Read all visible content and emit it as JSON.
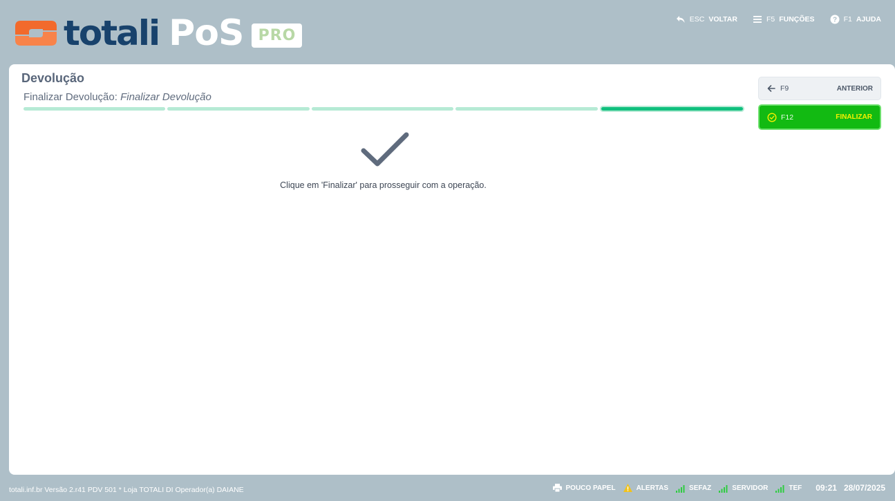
{
  "header": {
    "logo_word": "totali",
    "logo_pos": "PoS",
    "logo_badge": "PRO",
    "actions": [
      {
        "icon": "undo-icon",
        "key": "ESC",
        "label": "VOLTAR"
      },
      {
        "icon": "menu-icon",
        "key": "F5",
        "label": "FUNÇÕES"
      },
      {
        "icon": "help-icon",
        "key": "F1",
        "label": "AJUDA"
      }
    ]
  },
  "main": {
    "title": "Devolução",
    "step_prefix": "Finalizar Devolução:",
    "step_name": "Finalizar Devolução",
    "progress": {
      "total_steps": 5,
      "current_step": 5
    },
    "message": "Clique em 'Finalizar' para prosseguir com a operação.",
    "icon": "checkmark-icon"
  },
  "side": {
    "previous": {
      "icon": "arrow-left-icon",
      "key": "F9",
      "label": "ANTERIOR"
    },
    "finish": {
      "icon": "check-circle-icon",
      "key": "F12",
      "label": "FINALIZAR"
    }
  },
  "footer": {
    "info": "totali.inf.br Versão 2.r41 PDV 501  *  Loja TOTALI DI Operador(a) DAIANE",
    "paper": "POUCO PAPEL",
    "alerts": "ALERTAS",
    "sefaz": "SEFAZ",
    "server": "SERVIDOR",
    "tef": "TEF",
    "time": "09:21",
    "date": "28/07/2025"
  },
  "colors": {
    "background": "#aebfc8",
    "brand_dark": "#18426c",
    "brand_orange": "#f26a2c",
    "progress_light": "#b6ead5",
    "progress_active": "#10c07e",
    "finish_green": "#12ba12",
    "finish_label": "#f6f000",
    "alert_yellow": "#f1c21b",
    "signal_green": "#2ecc40"
  }
}
